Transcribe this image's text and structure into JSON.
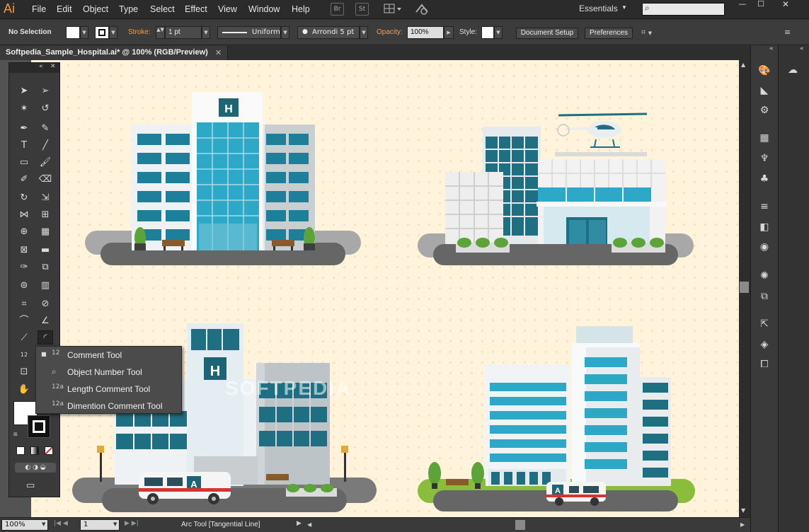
{
  "app": {
    "logo": "Ai"
  },
  "menu": [
    "File",
    "Edit",
    "Object",
    "Type",
    "Select",
    "Effect",
    "View",
    "Window",
    "Help"
  ],
  "menubar": {
    "bridge": "Br",
    "stock": "St",
    "workspace": "Essentials",
    "search_placeholder": ""
  },
  "control": {
    "selection": "No Selection",
    "stroke_label": "Stroke:",
    "stroke_weight": "1 pt",
    "profile": "Uniform",
    "brush": "Arrondi 5 pt",
    "opacity_label": "Opacity:",
    "opacity": "100%",
    "style_label": "Style:",
    "doc_setup": "Document Setup",
    "preferences": "Preferences"
  },
  "document": {
    "tab_title": "Softpedia_Sample_Hospital.ai* @ 100% (RGB/Preview)",
    "close": "✕"
  },
  "flyout": {
    "items": [
      {
        "label": "Comment Tool",
        "icon": "comment-tool-icon",
        "glyph": "12",
        "selected": true
      },
      {
        "label": "Object Number Tool",
        "icon": "object-number-tool-icon",
        "glyph": "⌕",
        "selected": false
      },
      {
        "label": "Length Comment Tool",
        "icon": "length-comment-tool-icon",
        "glyph": "12a",
        "selected": false
      },
      {
        "label": "Dimention Comment Tool",
        "icon": "dimention-comment-tool-icon",
        "glyph": "12a",
        "selected": false
      }
    ]
  },
  "watermark": "SOFTPEDIA",
  "status": {
    "zoom": "100%",
    "artboard": "1",
    "tool": "Arc Tool [Tangential Line]"
  },
  "signs": {
    "h1": "H",
    "h2": "H",
    "a1": "A",
    "a2": "A"
  },
  "colors": {
    "accent": "#f29a3a",
    "artboard": "#fff4db",
    "teal": "#2a9fbf",
    "dark_teal": "#1e6f82"
  }
}
